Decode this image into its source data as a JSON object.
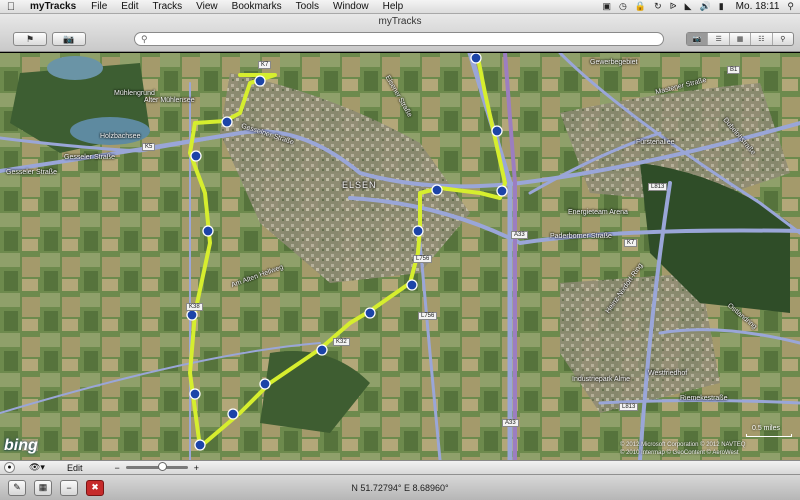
{
  "menubar": {
    "app_name": "myTracks",
    "items": [
      "File",
      "Edit",
      "Tracks",
      "View",
      "Bookmarks",
      "Tools",
      "Window",
      "Help"
    ],
    "clock": "Mo. 18:11"
  },
  "window": {
    "title": "myTracks"
  },
  "toolbar": {
    "flag_icon": "flag-icon",
    "camera_icon": "camera-icon",
    "search_placeholder": ""
  },
  "map": {
    "labels": {
      "place_elsen": "ELSEN",
      "gesseler_strasse_1": "Gesseler Straße",
      "gesseler_strasse_2": "Gesseler Straße",
      "gesselner_strasse": "Gesselner Straße",
      "holzbachsee": "Holzbachsee",
      "alter_muehlensee": "Alter Mühlensee",
      "muehlengrund": "Mühlengrund",
      "paderborner_strasse": "Paderborner Straße",
      "mastener_strasse": "Mastener Straße",
      "fuerstenallee": "Fürstenallee",
      "heinz_nixdorf_ring": "Heinz-Nixdorf-Ring",
      "industriepark_alme": "Industriepark Alme",
      "westfriedhof": "Westfriedhof",
      "energieteam_arena": "Energieteam Arena",
      "am_alten_hellweg": "Am Alten Hellweg",
      "elsener_strasse": "Elsener Straße",
      "gewerbegebiet": "Gewerbegebiet",
      "riemekestrasse": "Riemekestraße",
      "dubelohstrasse": "Dubelohstraße",
      "ostlandring": "Ostlandring"
    },
    "shields": {
      "k7_top": "K7",
      "k5": "K5",
      "b1": "B1",
      "l813_top": "L813",
      "k7_right": "K7",
      "a33_top": "A33",
      "a33_bottom": "A33",
      "l756": "L756",
      "l756b": "L756",
      "k38": "K38",
      "k32": "K32",
      "l813_bottom": "L813"
    },
    "track_color": "#d6ee2e",
    "bing_logo": "bing",
    "scale": "0.5 miles",
    "copyright_1": "© 2012 Microsoft Corporation © 2012 NAVTEQ",
    "copyright_2": "© 2010 Intermap © GeoContent © AeroWest"
  },
  "edit_toolbar": {
    "edit_label": "Edit",
    "zoom_minus": "−",
    "zoom_plus": "+",
    "zoom_level": 0.6
  },
  "status": {
    "coordinates": "N 51.72794°  E 8.68960°"
  }
}
